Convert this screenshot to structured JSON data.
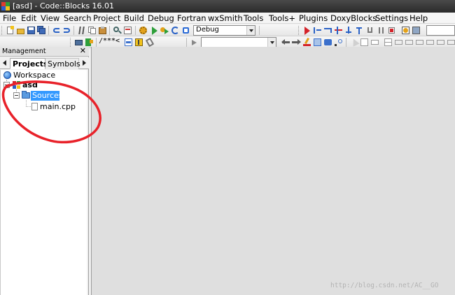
{
  "window": {
    "title": "[asd] - Code::Blocks 16.01"
  },
  "menu": [
    {
      "label": "File"
    },
    {
      "label": "Edit"
    },
    {
      "label": "View"
    },
    {
      "label": "Search"
    },
    {
      "label": "Project"
    },
    {
      "label": "Build"
    },
    {
      "label": "Debug"
    },
    {
      "label": "Fortran"
    },
    {
      "label": "wxSmith"
    },
    {
      "label": "Tools"
    },
    {
      "label": "Tools+"
    },
    {
      "label": "Plugins"
    },
    {
      "label": "DoxyBlocks"
    },
    {
      "label": "Settings"
    },
    {
      "label": "Help"
    }
  ],
  "toolbar": {
    "build_target": "Debug",
    "doxy_comment_block": "/**",
    "doxy_line_comment": "*<"
  },
  "management": {
    "title": "Management",
    "close_glyph": "✕",
    "tabs": [
      {
        "label": "Projects",
        "active": true
      },
      {
        "label": "Symbols",
        "active": false
      }
    ],
    "tree": {
      "workspace": "Workspace",
      "project": "asd",
      "folder": "Sources",
      "file": "main.cpp"
    }
  },
  "watermark": "http://blog.csdn.net/AC__GO",
  "colors": {
    "selection": "#3399ff",
    "editor_background": "#dfdfdf",
    "annotation": "#e8222a"
  }
}
